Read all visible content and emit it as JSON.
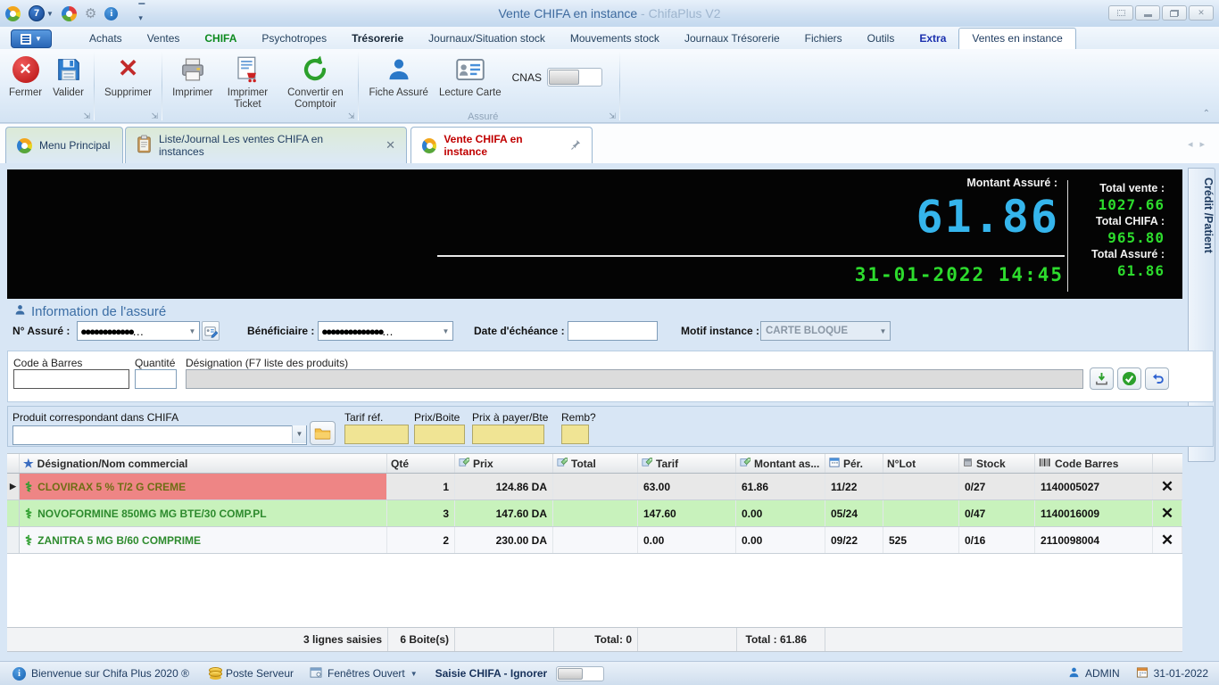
{
  "window": {
    "title": "Vente CHIFA en instance",
    "title_suffix": " - ChifaPlus V2"
  },
  "menu": {
    "items": [
      {
        "label": "Achats"
      },
      {
        "label": "Ventes"
      },
      {
        "label": "CHIFA"
      },
      {
        "label": "Psychotropes"
      },
      {
        "label": "Trésorerie"
      },
      {
        "label": "Journaux/Situation stock"
      },
      {
        "label": "Mouvements stock"
      },
      {
        "label": "Journaux Trésorerie"
      },
      {
        "label": "Fichiers"
      },
      {
        "label": "Outils"
      },
      {
        "label": "Extra"
      },
      {
        "label": "Ventes en instance"
      }
    ]
  },
  "toolbar": {
    "fermer": "Fermer",
    "valider": "Valider",
    "supprimer": "Supprimer",
    "imprimer": "Imprimer",
    "imprimer_ticket": "Imprimer Ticket",
    "convertir": "Convertir en Comptoir",
    "fiche_assure": "Fiche Assuré",
    "lecture_carte": "Lecture Carte",
    "cnas_label": "CNAS",
    "group_assure_label": "Assuré"
  },
  "tabs": [
    {
      "label": "Menu Principal"
    },
    {
      "label": "Liste/Journal Les ventes CHIFA en instances"
    },
    {
      "label": "Vente CHIFA en instance"
    }
  ],
  "display": {
    "montant_assure_label": "Montant Assuré :",
    "montant_assure_value": "61.86",
    "datetime": "31-01-2022 14:45",
    "totals": [
      {
        "label": "Total vente :",
        "value": "1027.66"
      },
      {
        "label": "Total CHIFA :",
        "value": "965.80"
      },
      {
        "label": "Total Assuré :",
        "value": "61.86"
      }
    ]
  },
  "side_tab_label": "Crédit /Patient",
  "assure": {
    "section_title": "Information de l'assuré",
    "num_assure_label": "N° Assuré :",
    "num_assure_value": "●●●●●●●●●●●●…",
    "beneficiaire_label": "Bénéficiaire :",
    "beneficiaire_value": "●●●●●●●●●●●●●●…",
    "date_echeance_label": "Date d'échéance :",
    "date_echeance_value": "",
    "motif_label": "Motif instance :",
    "motif_value": "CARTE BLOQUE"
  },
  "entry": {
    "code_barres_label": "Code à Barres",
    "quantite_label": "Quantité",
    "designation_label": "Désignation (F7 liste des produits)"
  },
  "produit": {
    "label": "Produit correspondant dans CHIFA",
    "tarif_ref_label": "Tarif réf.",
    "prix_boite_label": "Prix/Boite",
    "prix_payer_label": "Prix à payer/Bte",
    "remb_label": "Remb?"
  },
  "table": {
    "columns": {
      "designation": "Désignation/Nom commercial",
      "qte": "Qté",
      "prix": "Prix",
      "total": "Total",
      "tarif": "Tarif",
      "montant": "Montant as...",
      "per": "Pér.",
      "lot": "N°Lot",
      "stock": "Stock",
      "code": "Code Barres"
    },
    "rows": [
      {
        "name": "CLOVIRAX 5 % T/2 G CREME",
        "qte": "1",
        "prix": "124.86 DA",
        "total": "",
        "tarif": "63.00",
        "montant": "61.86",
        "per": "11/22",
        "lot": "",
        "stock": "0/27",
        "code": "1140005027"
      },
      {
        "name": "NOVOFORMINE 850MG MG BTE/30 COMP.PL",
        "qte": "3",
        "prix": "147.60 DA",
        "total": "",
        "tarif": "147.60",
        "montant": "0.00",
        "per": "05/24",
        "lot": "",
        "stock": "0/47",
        "code": "1140016009"
      },
      {
        "name": "ZANITRA 5 MG B/60 COMPRIME",
        "qte": "2",
        "prix": "230.00 DA",
        "total": "",
        "tarif": "0.00",
        "montant": "0.00",
        "per": "09/22",
        "lot": "525",
        "stock": "0/16",
        "code": "2110098004"
      }
    ],
    "summary": {
      "lignes": "3 lignes saisies",
      "boites": "6 Boite(s)",
      "total_left": "Total: 0",
      "total_right": "Total : 61.86"
    }
  },
  "statusbar": {
    "welcome": "Bienvenue sur Chifa Plus 2020 ®",
    "poste": "Poste Serveur",
    "fenetres": "Fenêtres Ouvert",
    "saisie": "Saisie CHIFA - Ignorer",
    "user": "ADMIN",
    "date": "31-01-2022"
  }
}
